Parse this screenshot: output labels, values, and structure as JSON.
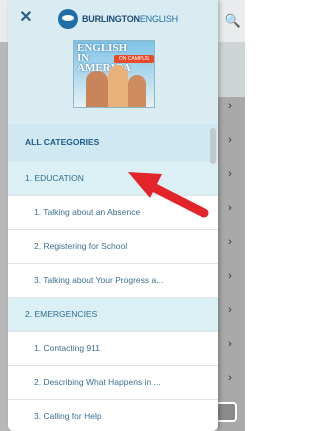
{
  "drawer": {
    "close_label": "✕",
    "brand_name": "BURLINGTON",
    "brand_suffix": "ENGLISH",
    "book": {
      "title": "ENGLISH IN AMERICA",
      "ribbon": "ON CAMPUS"
    },
    "all_categories_label": "ALL CATEGORIES",
    "rows": [
      {
        "type": "category",
        "label": "1. EDUCATION"
      },
      {
        "type": "item",
        "label": "1. Talking about an Absence"
      },
      {
        "type": "item",
        "label": "2. Registering for School"
      },
      {
        "type": "item",
        "label": "3. Talking about Your Progress a..."
      },
      {
        "type": "category",
        "label": "2. EMERGENCIES"
      },
      {
        "type": "item",
        "label": "1. Contacting 911"
      },
      {
        "type": "item",
        "label": "2. Describing What Happens in ..."
      },
      {
        "type": "item",
        "label": "3. Calling for Help"
      }
    ]
  },
  "background": {
    "search_icon": "search-icon",
    "chevron_icon": "chevron-right-icon"
  },
  "colors": {
    "header_bg": "#d9ecf1",
    "category_bg": "#dbf0f5",
    "text_blue": "#2f6c93",
    "arrow_red": "#e3242b"
  }
}
